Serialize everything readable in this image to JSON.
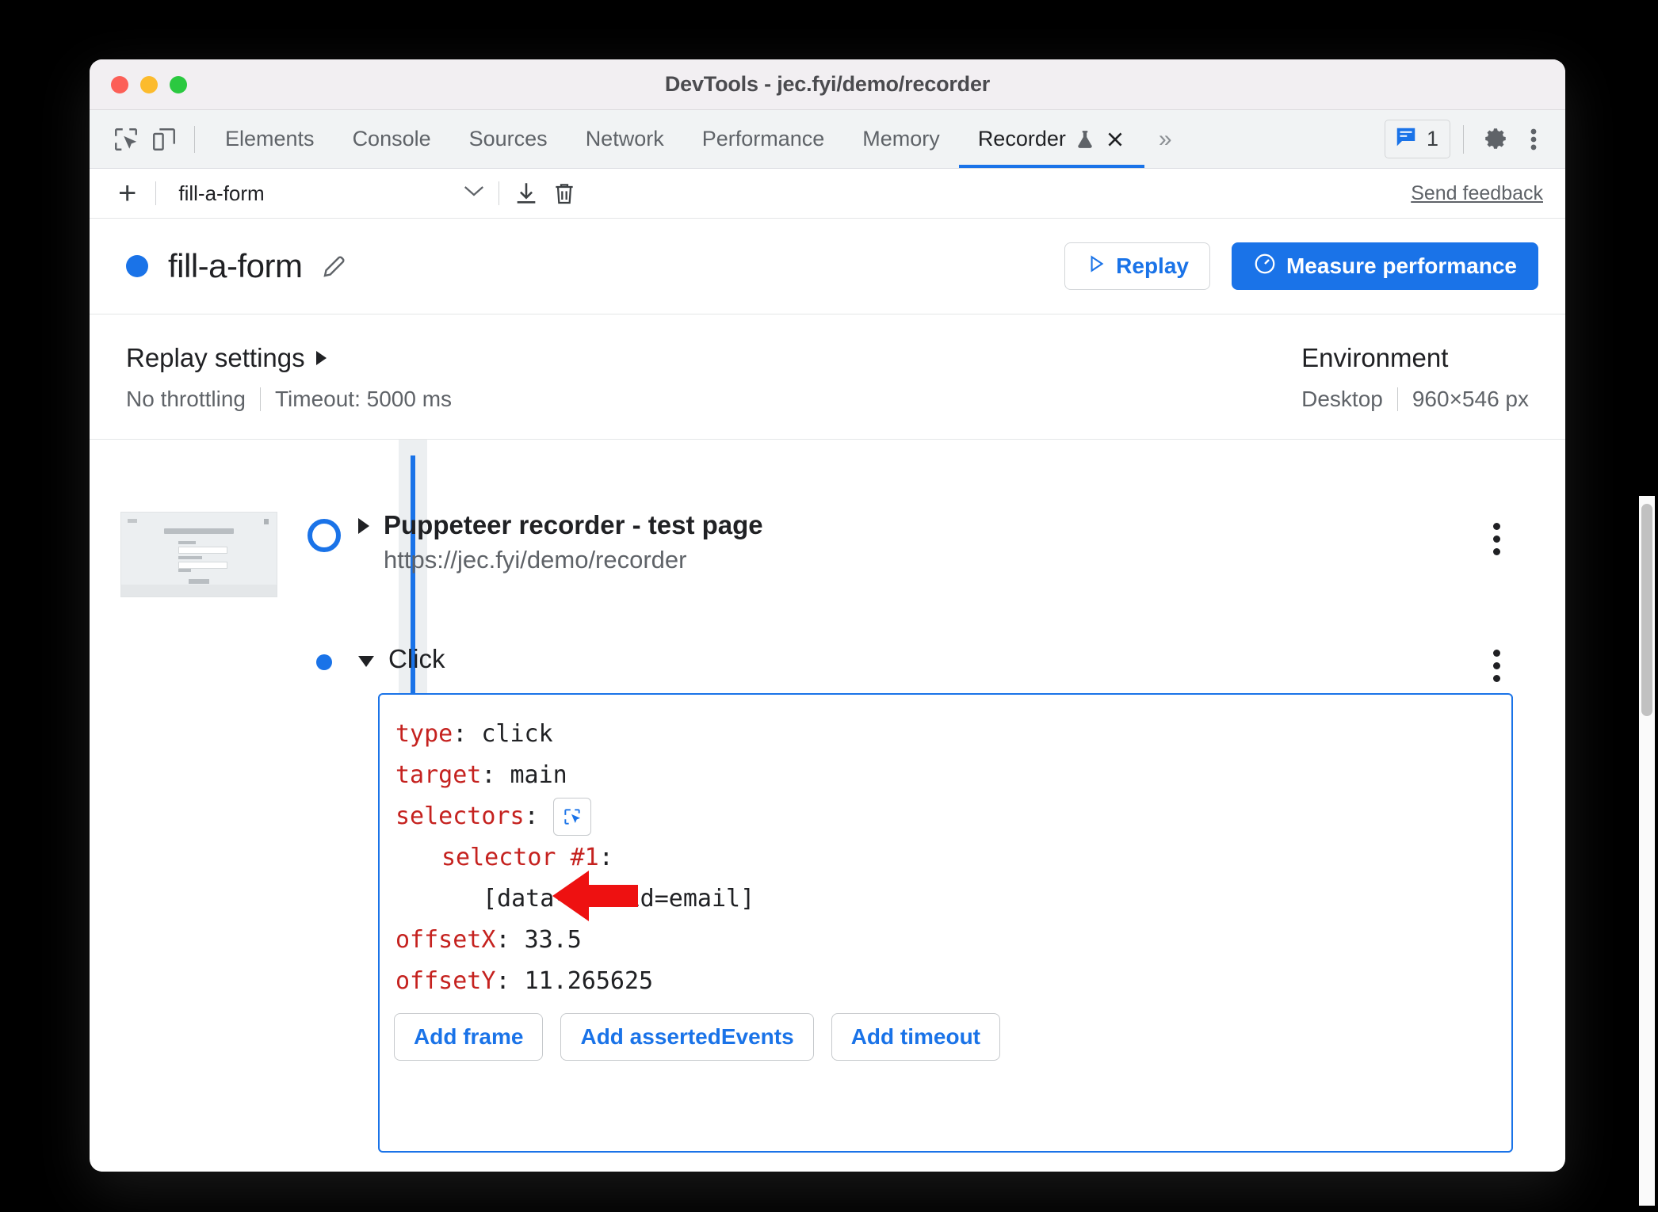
{
  "window": {
    "title": "DevTools - jec.fyi/demo/recorder",
    "traffic_lights": [
      "close",
      "minimize",
      "zoom"
    ]
  },
  "tabbar": {
    "left_icons": [
      "inspect-element-icon",
      "device-toolbar-icon"
    ],
    "tabs": [
      {
        "label": "Elements",
        "active": false
      },
      {
        "label": "Console",
        "active": false
      },
      {
        "label": "Sources",
        "active": false
      },
      {
        "label": "Network",
        "active": false
      },
      {
        "label": "Performance",
        "active": false
      },
      {
        "label": "Memory",
        "active": false
      },
      {
        "label": "Recorder",
        "active": true,
        "experiment_icon": "flask-icon",
        "closable": true
      }
    ],
    "overflow_label": "»",
    "message_count": "1",
    "message_icon": "console-message-icon",
    "settings_icon": "gear-icon",
    "more_icon": "kebab-menu-icon",
    "accent_color": "#1a73e8"
  },
  "recorder_toolbar": {
    "add_label": "+",
    "selected_recording": "fill-a-form",
    "dropdown_icon": "chevron-down-icon",
    "export_icon": "download-icon",
    "delete_icon": "trash-icon",
    "feedback_label": "Send feedback"
  },
  "recording_header": {
    "status_color": "#1a73e8",
    "title": "fill-a-form",
    "edit_icon": "pencil-icon",
    "replay_label": "Replay",
    "replay_icon": "play-triangle-icon",
    "measure_label": "Measure performance",
    "measure_icon": "performance-gauge-icon",
    "primary_color": "#1a73e8"
  },
  "settings": {
    "replay": {
      "title": "Replay settings",
      "expand_icon": "triangle-right-icon",
      "throttling": "No throttling",
      "timeout": "Timeout: 5000 ms"
    },
    "environment": {
      "title": "Environment",
      "device": "Desktop",
      "viewport": "960×546 px"
    }
  },
  "steps": [
    {
      "name": "Puppeteer recorder - test page",
      "url": "https://jec.fyi/demo/recorder",
      "expanded": false,
      "node_type": "start-ring",
      "menu_icon": "kebab-menu-icon",
      "thumbnail": "page-screenshot-thumbnail"
    },
    {
      "name": "Click",
      "expanded": true,
      "node_type": "step-dot",
      "menu_icon": "kebab-menu-icon",
      "code": [
        {
          "key": "type",
          "value": "click",
          "indent": 0
        },
        {
          "key": "target",
          "value": "main",
          "indent": 0
        },
        {
          "key": "selectors",
          "value": "",
          "indent": 0,
          "button": "select-element-icon"
        },
        {
          "key": "selector #1",
          "value": "",
          "indent": 1
        },
        {
          "key": "",
          "value": "[data-testid=email]",
          "indent": 2,
          "annotated": true
        },
        {
          "key": "offsetX",
          "value": "33.5",
          "indent": 0
        },
        {
          "key": "offsetY",
          "value": "11.265625",
          "indent": 0
        }
      ],
      "add_buttons": [
        "Add frame",
        "Add assertedEvents",
        "Add timeout"
      ]
    }
  ],
  "annotation": {
    "arrow_color": "#ee1111",
    "points_at": "[data-testid=email]"
  },
  "scrollbar": {
    "orientation": "vertical"
  }
}
